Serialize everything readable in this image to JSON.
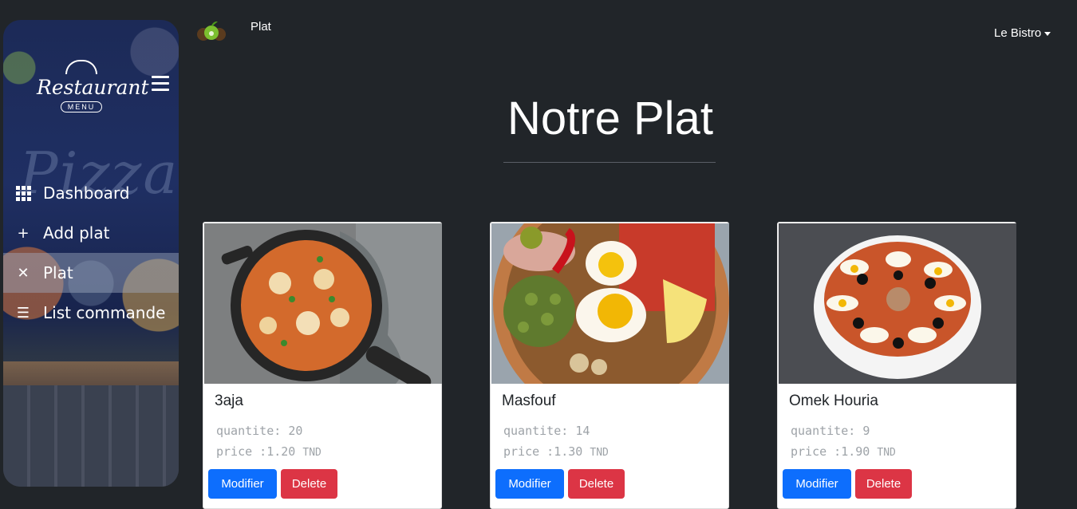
{
  "sidebar": {
    "logo_text": "Restaurant",
    "logo_sub": "MENU",
    "background_word": "Pizza",
    "items": [
      {
        "label": "Dashboard",
        "icon": "grid-icon"
      },
      {
        "label": "Add plat",
        "icon": "plus-icon"
      },
      {
        "label": "Plat",
        "icon": "utensils-icon",
        "active": true
      },
      {
        "label": "List commande",
        "icon": "list-ordered-icon"
      }
    ]
  },
  "topnav": {
    "link": "Plat",
    "dropdown": "Le Bistro"
  },
  "page": {
    "title": "Notre Plat"
  },
  "labels": {
    "quantite": "quantite:",
    "price": "price :",
    "currency": "TND",
    "modify": "Modifier",
    "delete": "Delete"
  },
  "plats": [
    {
      "name": "3aja",
      "quantite": "20",
      "price": "1.20"
    },
    {
      "name": "Masfouf",
      "quantite": "14",
      "price": "1.30"
    },
    {
      "name": "Omek Houria",
      "quantite": "9",
      "price": "1.90"
    }
  ],
  "colors": {
    "background": "#212529",
    "primary": "#0d6efd",
    "danger": "#dc3545"
  }
}
